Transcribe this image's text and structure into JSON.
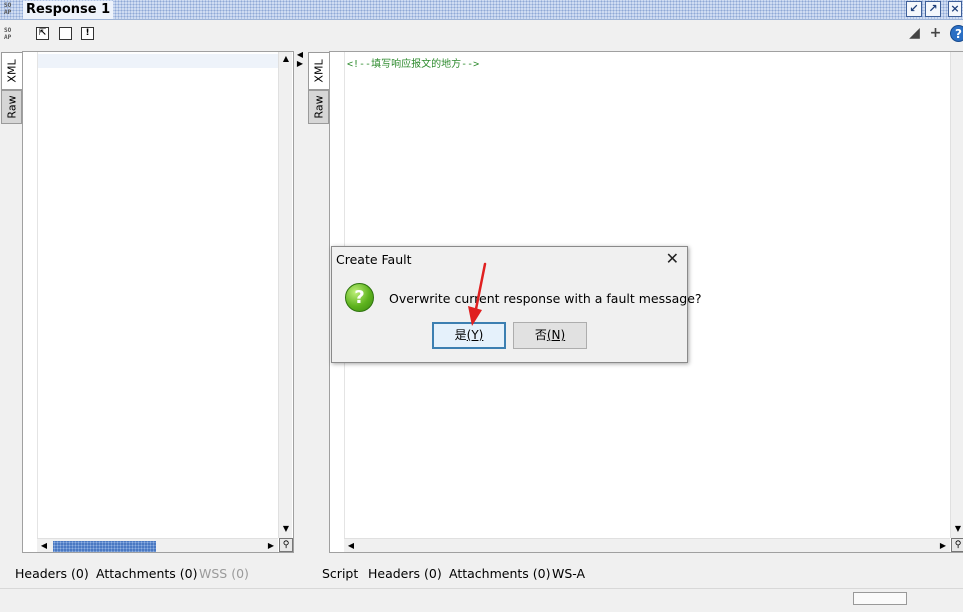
{
  "window": {
    "logo_text": "SO AP",
    "title": "Response 1",
    "controls": [
      "restore",
      "maximize",
      "close"
    ]
  },
  "toolbar": {
    "left_buttons": [
      "fit-icon",
      "square-icon",
      "exclamation-icon"
    ],
    "right_buttons": [
      "edit-icon",
      "add-icon",
      "help-icon"
    ],
    "help_label": "?"
  },
  "left_panel": {
    "tabs": [
      "XML",
      "Raw"
    ],
    "bottom_tabs": [
      {
        "label": "Headers (0)",
        "enabled": true
      },
      {
        "label": "Attachments (0)",
        "enabled": true
      },
      {
        "label": "WSS (0)",
        "enabled": false
      }
    ]
  },
  "right_panel": {
    "tabs": [
      "XML",
      "Raw"
    ],
    "content_line": "<!--填写响应报文的地方-->",
    "bottom_tabs": [
      {
        "label": "Script"
      },
      {
        "label": "Headers (0)"
      },
      {
        "label": "Attachments (0)"
      },
      {
        "label": "WS-A"
      }
    ]
  },
  "dialog": {
    "title": "Create Fault",
    "message": "Overwrite current response with a fault message?",
    "icon": "question-icon",
    "yes_label": "是",
    "yes_mnemonic": "(Y)",
    "no_label": "否",
    "no_mnemonic": "(N)"
  },
  "colors": {
    "title_bar": "#cfdcf2",
    "scroll_thumb": "#4a78c2",
    "comment_text": "#2e8b2e",
    "annotation_arrow": "#e02020"
  }
}
